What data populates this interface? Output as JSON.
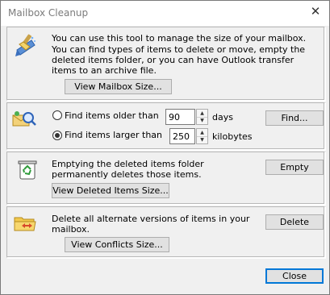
{
  "window": {
    "title": "Mailbox Cleanup",
    "close_glyph": "✕"
  },
  "mailbox_size": {
    "intro": "You can use this tool to manage the size of your mailbox.",
    "description": "You can find types of items to delete or move, empty the deleted items folder, or you can have Outlook transfer items to an archive file.",
    "button": "View Mailbox Size...",
    "icon": "mailbox-cleanup-broom-icon"
  },
  "find": {
    "older_label": "Find items older than",
    "older_value": "90",
    "older_unit": "days",
    "larger_label": "Find items larger than",
    "larger_value": "250",
    "larger_unit": "kilobytes",
    "selected": "larger",
    "button": "Find...",
    "icon": "find-items-icon"
  },
  "deleted": {
    "description": "Emptying the deleted items folder permanently deletes those items.",
    "empty_button": "Empty",
    "view_button": "View Deleted Items Size...",
    "icon": "recycle-bin-icon"
  },
  "conflicts": {
    "description": "Delete all alternate versions of items in your mailbox.",
    "delete_button": "Delete",
    "view_button": "View Conflicts Size...",
    "icon": "conflicts-folder-icon"
  },
  "footer": {
    "close_button": "Close"
  },
  "colors": {
    "accent": "#0078d7",
    "dialog_bg": "#f0f0f0",
    "button_bg": "#e1e1e1"
  }
}
